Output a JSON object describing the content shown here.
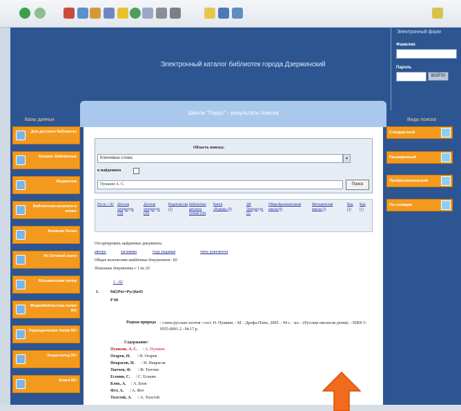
{
  "site": {
    "title": "Электронный каталог библиотек города Дзержинский"
  },
  "login": {
    "title": "Электронный форм",
    "label_name": "Фамилия",
    "label_password": "Пароль",
    "button": "ВОЙТИ"
  },
  "left_column": {
    "title": "Базы данных",
    "items": [
      {
        "label": "Для детского библиотек"
      },
      {
        "label": "Каталог библиотеки"
      },
      {
        "label": "Медиатека"
      },
      {
        "label": "Библиотеки каталоги и книжн"
      },
      {
        "label": "Книжная Полка"
      },
      {
        "label": "Из Сетевой книги"
      },
      {
        "label": "Музыкальная полки"
      },
      {
        "label": "Медиабиблиотека полки RU"
      },
      {
        "label": "Периодические полки RU"
      },
      {
        "label": "Энциклопед RU"
      },
      {
        "label": "Книги RU"
      }
    ]
  },
  "right_column": {
    "title": "Виды поиска",
    "items": [
      {
        "label": "Стандартный"
      },
      {
        "label": "Расширенный"
      },
      {
        "label": "Профессиональный"
      },
      {
        "label": "По словарю"
      }
    ]
  },
  "panel": {
    "title": "Школа \"Парус\" - результаты поиска",
    "search_area_label": "Область поиска:",
    "select_value": "Ключевые слова",
    "found_label": "в найденном",
    "query_value": "Пушкин А. С.",
    "search_button": "Поиск",
    "filters": [
      "Русск. = 82",
      "Детская литература (10)",
      "Детская литература (10)",
      "Издательства (2)",
      "Библиотека детского чтения (18)",
      "Книги «Родная» (9)",
      "ДВ Литература (1)",
      "Общеобразовательная школа (8)",
      "Методическая школа (3)",
      "Вид (2)",
      "Вид (1)"
    ],
    "sort_label": "Отсортировать найденные документы",
    "sort_links": [
      "автору",
      "заглавию",
      "году издания",
      "типу документа"
    ],
    "total_label": "Общее количество найденных документов : 82",
    "shown_label": "Показаны документы с 1 по 20",
    "page_label": "1 - 82",
    "record": {
      "num": "1.",
      "udc": "84(2Рос=Рус)6я43",
      "code": "Р 60",
      "title": "Родная природа",
      "desc": ": стихи русских поэтов / сост. Н. Пушкин. - М. : Дрофа-Плюс, 2005. - 94 с. : ил. - (Русские писатели детям). - ISBN 5-9555-0091-2 : 94.17 р.",
      "contents_label": "Содержание:",
      "contents": [
        {
          "name": "Пушкин, А. С.",
          "tail": "/ А. Пушкин",
          "highlight": true
        },
        {
          "name": "Огарев, Н.",
          "tail": "/ Н. Огарев",
          "highlight": false
        },
        {
          "name": "Некрасов, Н.",
          "tail": "/ Н. Некрасов",
          "highlight": false
        },
        {
          "name": "Тютчев, Ф.",
          "tail": "/ Ф. Тютчев",
          "highlight": false
        },
        {
          "name": "Есенин, С.",
          "tail": "/ С. Есенин",
          "highlight": false
        },
        {
          "name": "Блок, А.",
          "tail": "/ А. Блок",
          "highlight": false
        },
        {
          "name": "Фет, А.",
          "tail": "/ А. Фет",
          "highlight": false
        },
        {
          "name": "Толстой, А.",
          "tail": "/ А. Толстой",
          "highlight": false
        }
      ]
    }
  },
  "colors": {
    "site_bg": "#2b5189",
    "accent_orange": "#f39a1e",
    "panel_head": "#a9c8ec",
    "link": "#1c2b99",
    "highlight": "#c0162b",
    "arrow": "#f26a1b"
  }
}
